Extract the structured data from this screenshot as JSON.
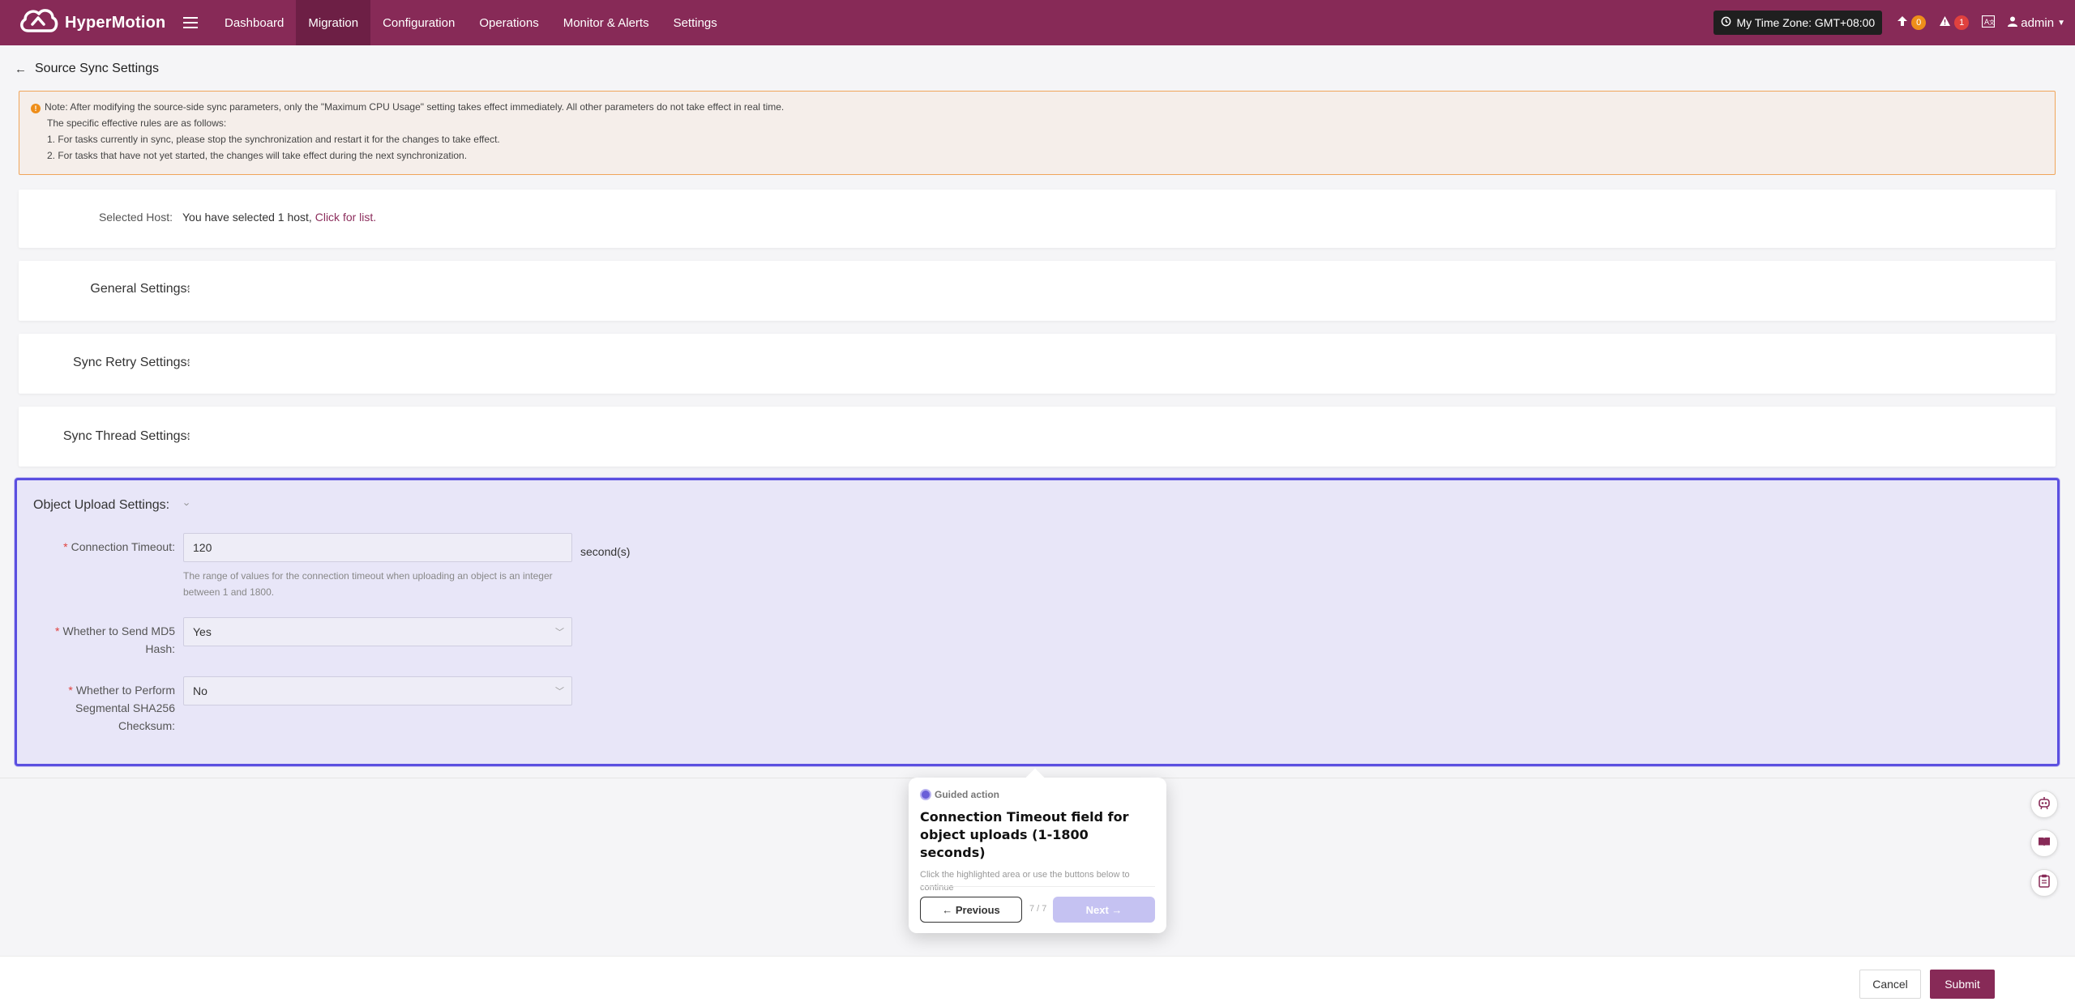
{
  "app": {
    "logo_text": "HyperMotion"
  },
  "nav": {
    "items": [
      {
        "label": "Dashboard"
      },
      {
        "label": "Migration"
      },
      {
        "label": "Configuration"
      },
      {
        "label": "Operations"
      },
      {
        "label": "Monitor & Alerts"
      },
      {
        "label": "Settings"
      }
    ],
    "active": "Migration"
  },
  "header": {
    "timezone": "My Time Zone: GMT+08:00",
    "upload_count": "0",
    "alert_count": "1",
    "user": "admin"
  },
  "page": {
    "title": "Source Sync Settings"
  },
  "notice": {
    "line1": "Note: After modifying the source-side sync parameters, only the \"Maximum CPU Usage\" setting takes effect immediately. All other parameters do not take effect in real time.",
    "line2": "The specific effective rules are as follows:",
    "line3": "1. For tasks currently in sync, please stop the synchronization and restart it for the changes to take effect.",
    "line4": "2. For tasks that have not yet started, the changes will take effect during the next synchronization."
  },
  "selected_host": {
    "label": "Selected Host:",
    "text": "You have selected 1 host, ",
    "link": "Click for list."
  },
  "sections": {
    "general": "General Settings:",
    "retry": "Sync Retry Settings:",
    "thread": "Sync Thread Settings:",
    "object_upload": "Object Upload Settings:"
  },
  "object_upload": {
    "connection_timeout": {
      "label": "Connection Timeout:",
      "value": "120",
      "unit": "second(s)",
      "hint": "The range of values for the connection timeout when uploading an object is an integer between 1 and 1800."
    },
    "send_md5": {
      "label_line1": "Whether to Send MD5",
      "label_line2": "Hash:",
      "value": "Yes"
    },
    "sha256": {
      "label_line1": "Whether to Perform",
      "label_line2": "Segmental SHA256",
      "label_line3": "Checksum:",
      "value": "No"
    }
  },
  "guide": {
    "header": "Guided action",
    "title": "Connection Timeout field for object uploads (1-1800 seconds)",
    "desc": "Click the highlighted area or use the buttons below to continue",
    "prev": "← Previous",
    "count": "7 / 7",
    "next": "Next →"
  },
  "footer": {
    "cancel": "Cancel",
    "submit": "Submit"
  },
  "colors": {
    "brand": "#872a57",
    "highlight_border": "#5b4fe0",
    "highlight_bg": "#e8e6f8",
    "warning": "#ee8e1a",
    "danger": "#e0413e"
  }
}
